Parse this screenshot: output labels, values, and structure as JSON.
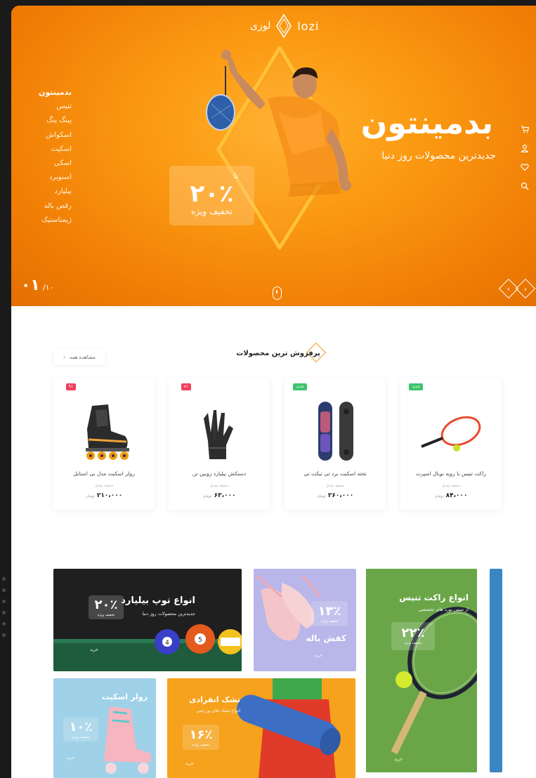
{
  "brand": {
    "name_fa": "لوزی",
    "name_en": "lozi"
  },
  "hero": {
    "title": "بدمینتون",
    "subtitle": "جدیدترین محصولات روز دنیا",
    "discount": {
      "upto": "تا",
      "percent": "۲۰٪",
      "label": "تخفیف ویژه"
    },
    "categories": [
      "بدمینتون",
      "تنیس",
      "پینگ پنگ",
      "اسکواش",
      "اسکیت",
      "اسکی",
      "اسنوبرد",
      "بیلیارد",
      "رقص باله",
      "ژیمناستیک"
    ],
    "slide_current": "۰۱",
    "slide_total": "/۱۰",
    "icons": [
      "cart-icon",
      "user-icon",
      "heart-icon",
      "search-icon"
    ],
    "arrow_prev": "‹",
    "arrow_next": "›"
  },
  "bestsellers": {
    "title": "پرفروش ترین محصولات",
    "view_all": "مشاهده همه",
    "view_all_arrow": "‹",
    "products": [
      {
        "name": "راکت تنیس با رویه نوبال اسپرت",
        "category": "دسته بندی",
        "price": "۸۴،۰۰۰",
        "currency": "تومان",
        "badge": "جدید",
        "badge_color": "green",
        "image": "tennis-racket"
      },
      {
        "name": "تخته اسکیت برد تی تیکت تی",
        "category": "دسته بندی",
        "price": "۲۶۰،۰۰۰",
        "currency": "تومان",
        "badge": "جدید",
        "badge_color": "green",
        "image": "skateboard"
      },
      {
        "name": "دستکش بیلیارد زوبین تن",
        "category": "دسته بندی",
        "price": "۶۳،۰۰۰",
        "currency": "تومان",
        "badge": "۸٪",
        "badge_color": "red",
        "image": "billiard-glove"
      },
      {
        "name": "رولر اسکیت مدل بی استایل",
        "category": "دسته بندی",
        "price": "۲۱۰،۰۰۰",
        "currency": "تومان",
        "badge": "۹٪",
        "badge_color": "red",
        "image": "roller-skate"
      }
    ]
  },
  "banners": {
    "billiard": {
      "title": "انواع توپ بیلیارد",
      "subtitle": "جدیدترین محصولات روز دنیا",
      "percent": "۲۰٪",
      "label": "تخفیف ویژه",
      "buy": "خرید"
    },
    "ballet": {
      "title": "کفش باله",
      "percent": "۱۳٪",
      "label": "تخفیف ویژه",
      "buy": "خرید"
    },
    "tennis": {
      "title": "انواع راکت تنیس",
      "subtitle": "از تنیس بورد های تخصصی",
      "percent": "۲۲٪",
      "label": "تخفیف ویژه",
      "buy": "خرید"
    },
    "roller": {
      "title": "رولر اسکیت",
      "percent": "۱۰٪",
      "label": "تخفیف ویژه",
      "buy": "خرید"
    },
    "mat": {
      "title": "تشک انفرادی",
      "subtitle": "انواع تشک های ورزشی",
      "percent": "۱۶٪",
      "label": "تخفیف ویژه",
      "buy": "خرید"
    }
  },
  "colors": {
    "accent": "#f7930f",
    "hero_dark": "#e46f02",
    "badge_red": "#ef3f5a",
    "badge_green": "#3ec46d"
  }
}
